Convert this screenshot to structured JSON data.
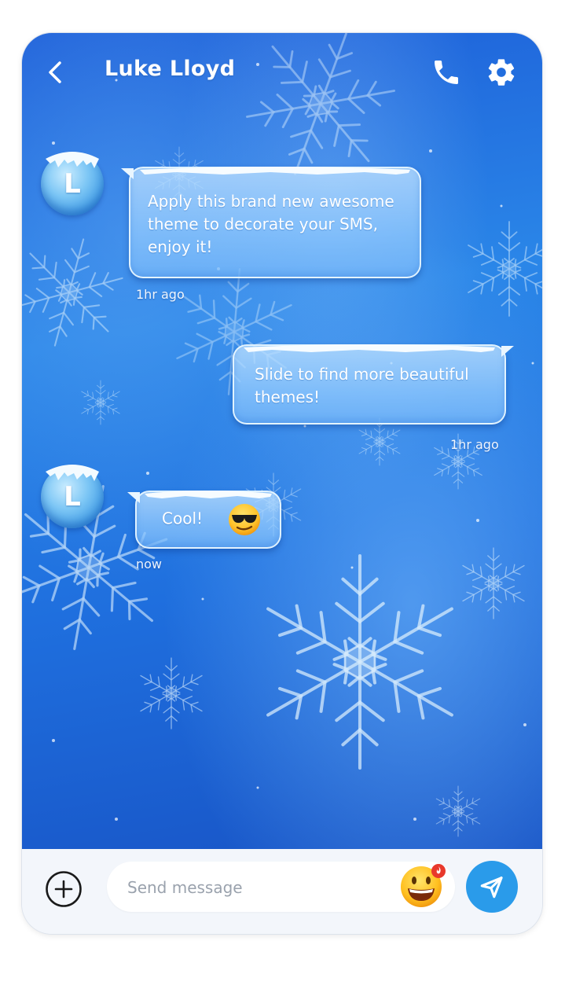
{
  "header": {
    "contact_name": "Luke Lloyd",
    "back_icon": "chevron-left-icon",
    "call_icon": "phone-icon",
    "settings_icon": "gear-icon"
  },
  "messages": [
    {
      "direction": "incoming",
      "avatar_letter": "L",
      "text": "Apply this brand new awesome theme to decorate your SMS, enjoy it!",
      "time": "1hr ago"
    },
    {
      "direction": "outgoing",
      "text": "Slide to find more beautiful themes!",
      "time": "1hr ago"
    },
    {
      "direction": "incoming",
      "avatar_letter": "L",
      "text": "Cool!",
      "emoji": "smiling-face-with-sunglasses",
      "time": "now"
    }
  ],
  "composer": {
    "placeholder": "Send message",
    "add_icon": "plus-circle-icon",
    "emoji_icon": "grinning-face-icon",
    "send_icon": "paper-plane-icon"
  },
  "colors": {
    "chat_background": "#2a86e8",
    "send_button": "#2a9bea",
    "emoji_badge": "#e8382b"
  }
}
